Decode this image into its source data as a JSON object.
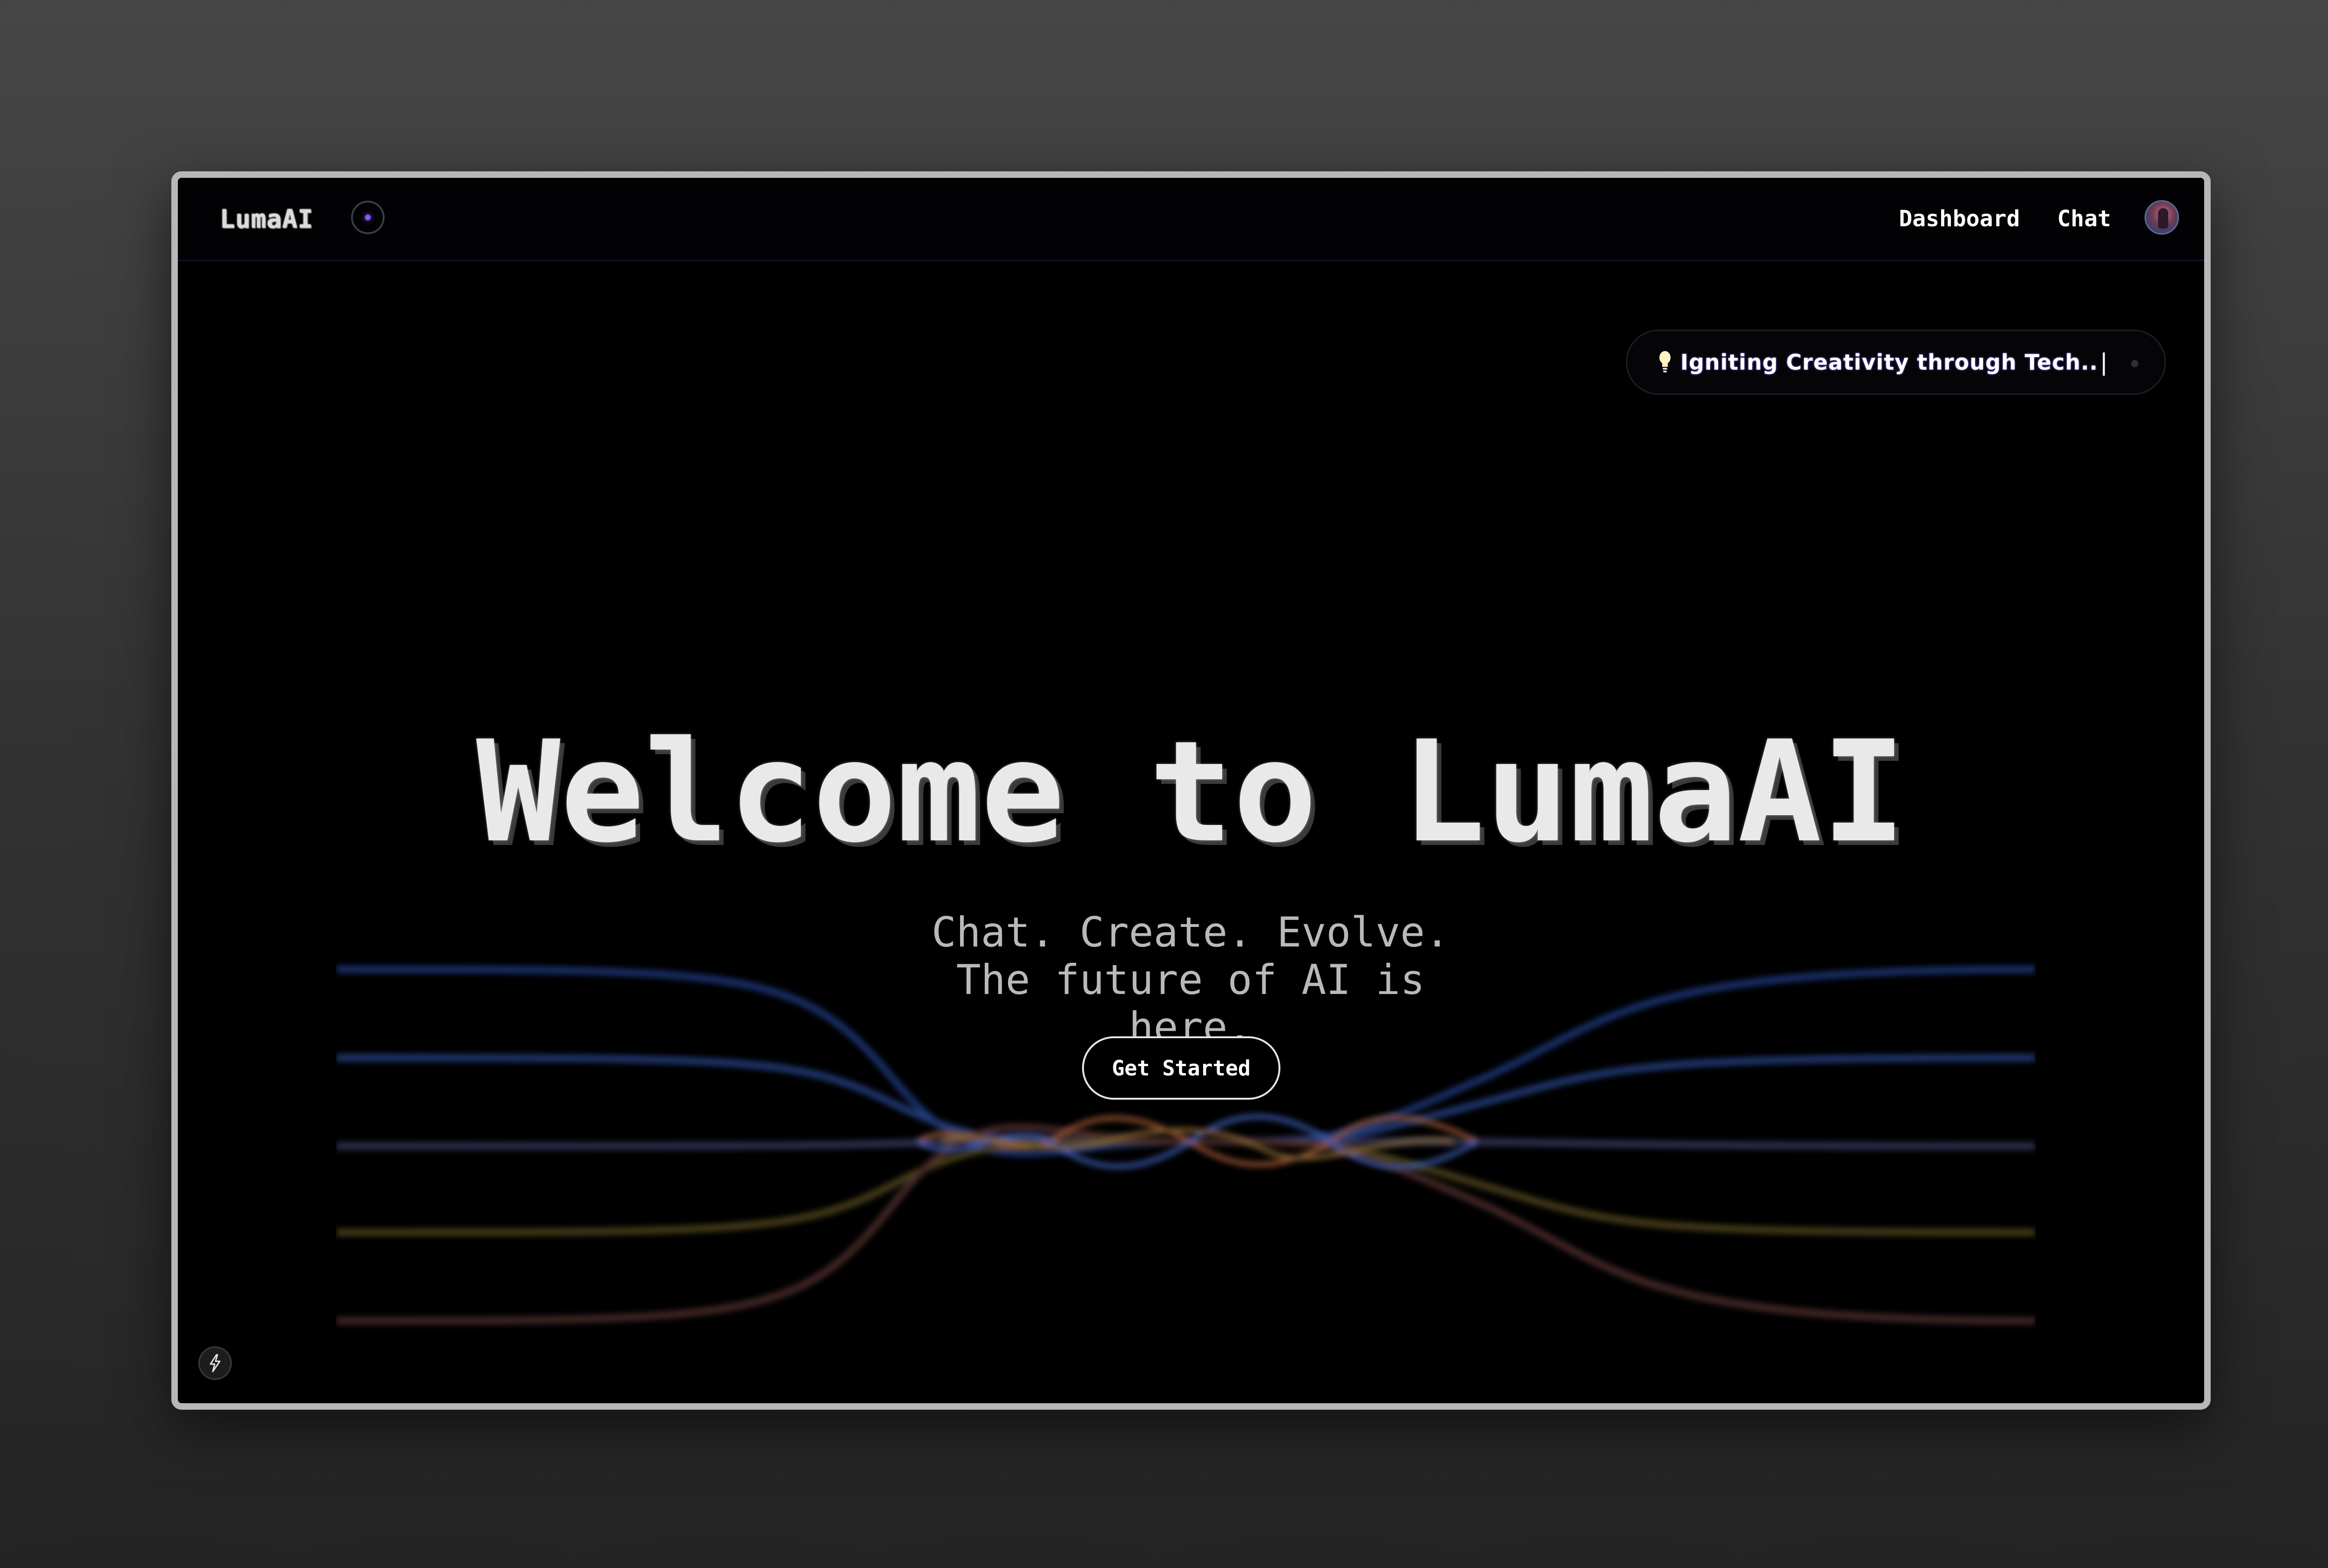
{
  "navbar": {
    "brand": "LumaAI",
    "links": [
      {
        "label": "Dashboard"
      },
      {
        "label": "Chat"
      }
    ],
    "avatar_icon": "user-avatar"
  },
  "tagline": {
    "icon": "lightbulb-icon",
    "text": "Igniting Creativity through Tech..",
    "cursor": "|"
  },
  "hero": {
    "title": "Welcome to LumaAI",
    "subtitle": "Chat. Create. Evolve. The future of AI is here.",
    "cta_label": "Get Started"
  },
  "corner_badge": {
    "icon": "lightning-bolt-icon"
  },
  "colors": {
    "background": "#000000",
    "accent_purple": "#8a57ff",
    "wave_blue": "#2c4ea8",
    "wave_orange": "#b0643a",
    "wave_yellow": "#8d7a2e",
    "text_primary": "#ffffff",
    "text_muted": "#b9b9b9"
  }
}
